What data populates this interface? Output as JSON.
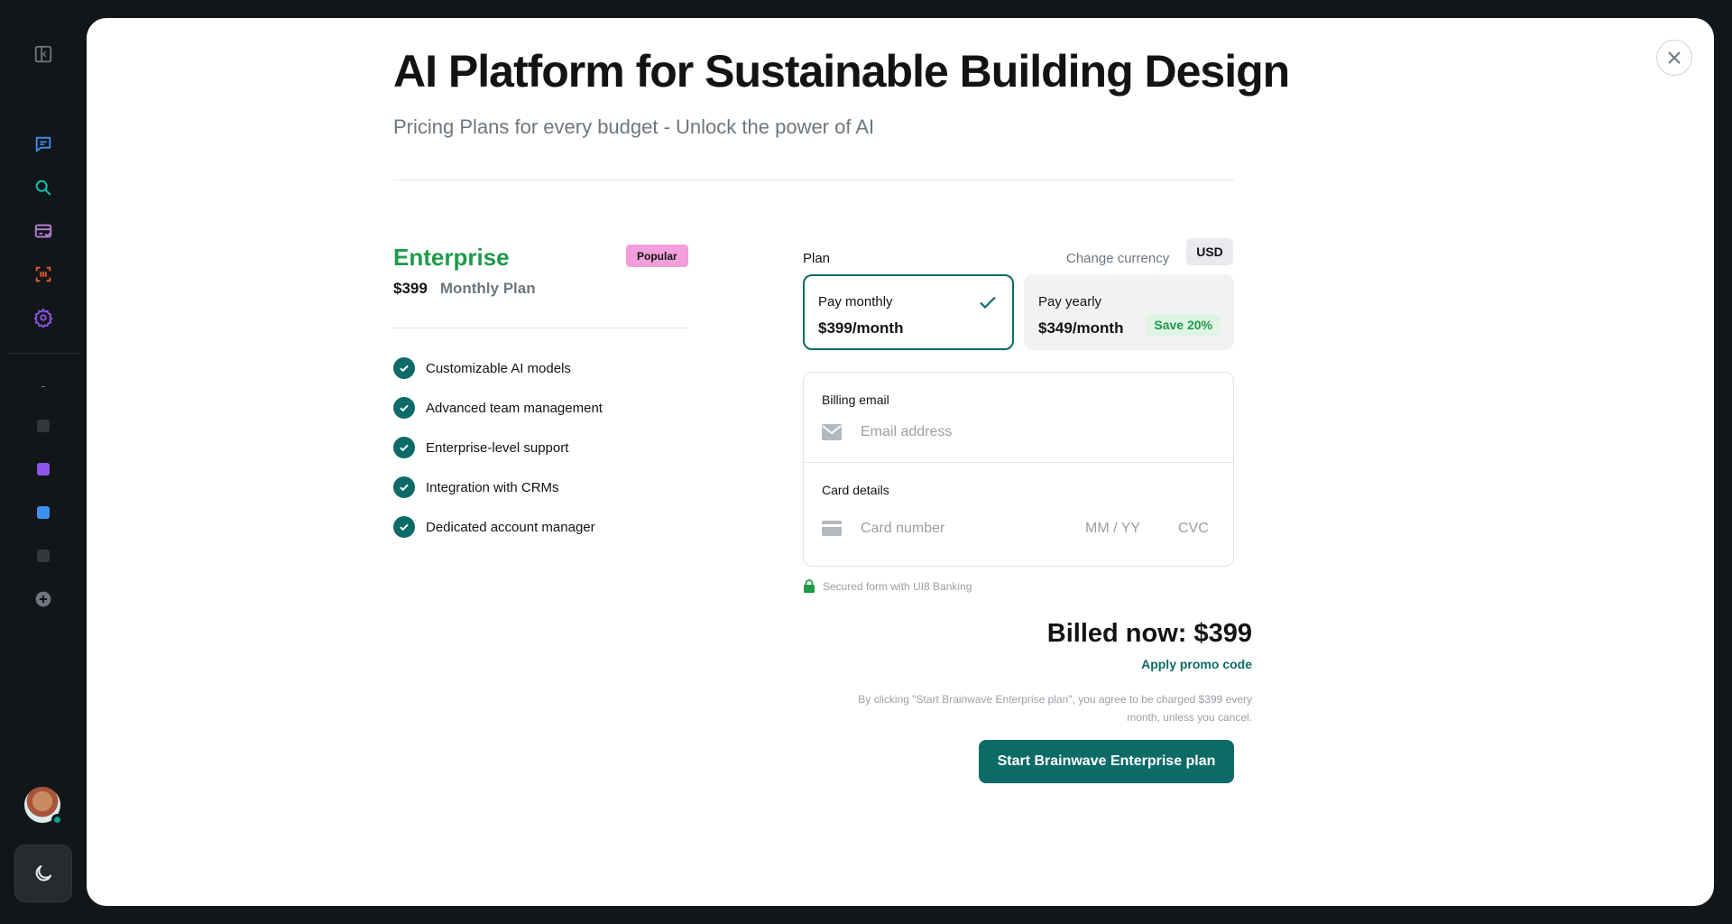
{
  "sidebar": {
    "items": [
      {
        "name": "toggle-sidebar",
        "icon": "panel-icon",
        "color": "#6f767e"
      },
      {
        "name": "chat",
        "icon": "chat-icon",
        "color": "#3e90f0"
      },
      {
        "name": "search",
        "icon": "search-icon",
        "color": "#0ac4b0"
      },
      {
        "name": "billing",
        "icon": "card-icon",
        "color": "#b981da"
      },
      {
        "name": "scan",
        "icon": "scan-icon",
        "color": "#ea5b2c"
      },
      {
        "name": "settings",
        "icon": "gear-icon",
        "color": "#8e55ea"
      }
    ],
    "dots": [
      "#33383f",
      "#8e55ea",
      "#3e90f0",
      "#33383f"
    ],
    "add_icon": "plus-circle-icon",
    "theme_icon": "moon-icon"
  },
  "modal": {
    "title": "AI Platform for Sustainable Building Design",
    "subtitle": "Pricing Plans for every budget - Unlock the power of AI"
  },
  "plan": {
    "name": "Enterprise",
    "badge": "Popular",
    "price": "$399",
    "period": "Monthly Plan",
    "features": [
      "Customizable AI models",
      "Advanced team management",
      "Enterprise-level support",
      "Integration with CRMs",
      "Dedicated account manager"
    ]
  },
  "checkout": {
    "plan_label": "Plan",
    "currency_label": "Change currency",
    "currency": "USD",
    "monthly": {
      "label": "Pay monthly",
      "amount": "$399/month",
      "selected": true
    },
    "yearly": {
      "label": "Pay yearly",
      "amount": "$349/month",
      "badge": "Save 20%"
    },
    "billing_email_label": "Billing email",
    "email_placeholder": "Email address",
    "card_details_label": "Card details",
    "card_placeholder": "Card number",
    "expiry_placeholder": "MM / YY",
    "cvc_placeholder": "CVC",
    "secure_text": "Secured form with UI8 Banking",
    "billed_now": "Billed now: $399",
    "promo": "Apply promo code",
    "terms": "By clicking \"Start Brainwave Enterprise plan\", you agree to be charged $399 every month, unless you cancel.",
    "cta": "Start Brainwave Enterprise plan"
  },
  "colors": {
    "accent": "#0c6b67",
    "brand_green": "#1f9a4b",
    "popular": "#f29fdb"
  }
}
